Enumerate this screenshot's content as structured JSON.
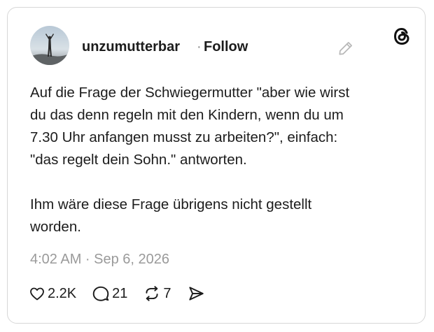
{
  "post": {
    "username": "unzumutterbar",
    "separator": "·",
    "follow_label": "Follow",
    "paragraph1_lines": [
      "Auf die Frage der Schwiegermutter \"aber wie wirst",
      "du das denn regeln mit den Kindern, wenn du um",
      "7.30 Uhr anfangen musst zu arbeiten?\", einfach:",
      "\"das regelt dein Sohn.\" antworten."
    ],
    "paragraph2_lines": [
      "Ihm wäre diese Frage übrigens nicht gestellt",
      "worden."
    ],
    "timestamp": "4:02 AM · Sep 6, 2026"
  },
  "actions": {
    "likes": "2.2K",
    "replies": "21",
    "reposts": "7"
  },
  "icons": {
    "avatar": "avatar-photo",
    "edit": "pencil-icon",
    "logo": "threads-logo-icon",
    "like": "heart-icon",
    "reply": "comment-icon",
    "repost": "repost-icon",
    "share": "send-icon"
  }
}
